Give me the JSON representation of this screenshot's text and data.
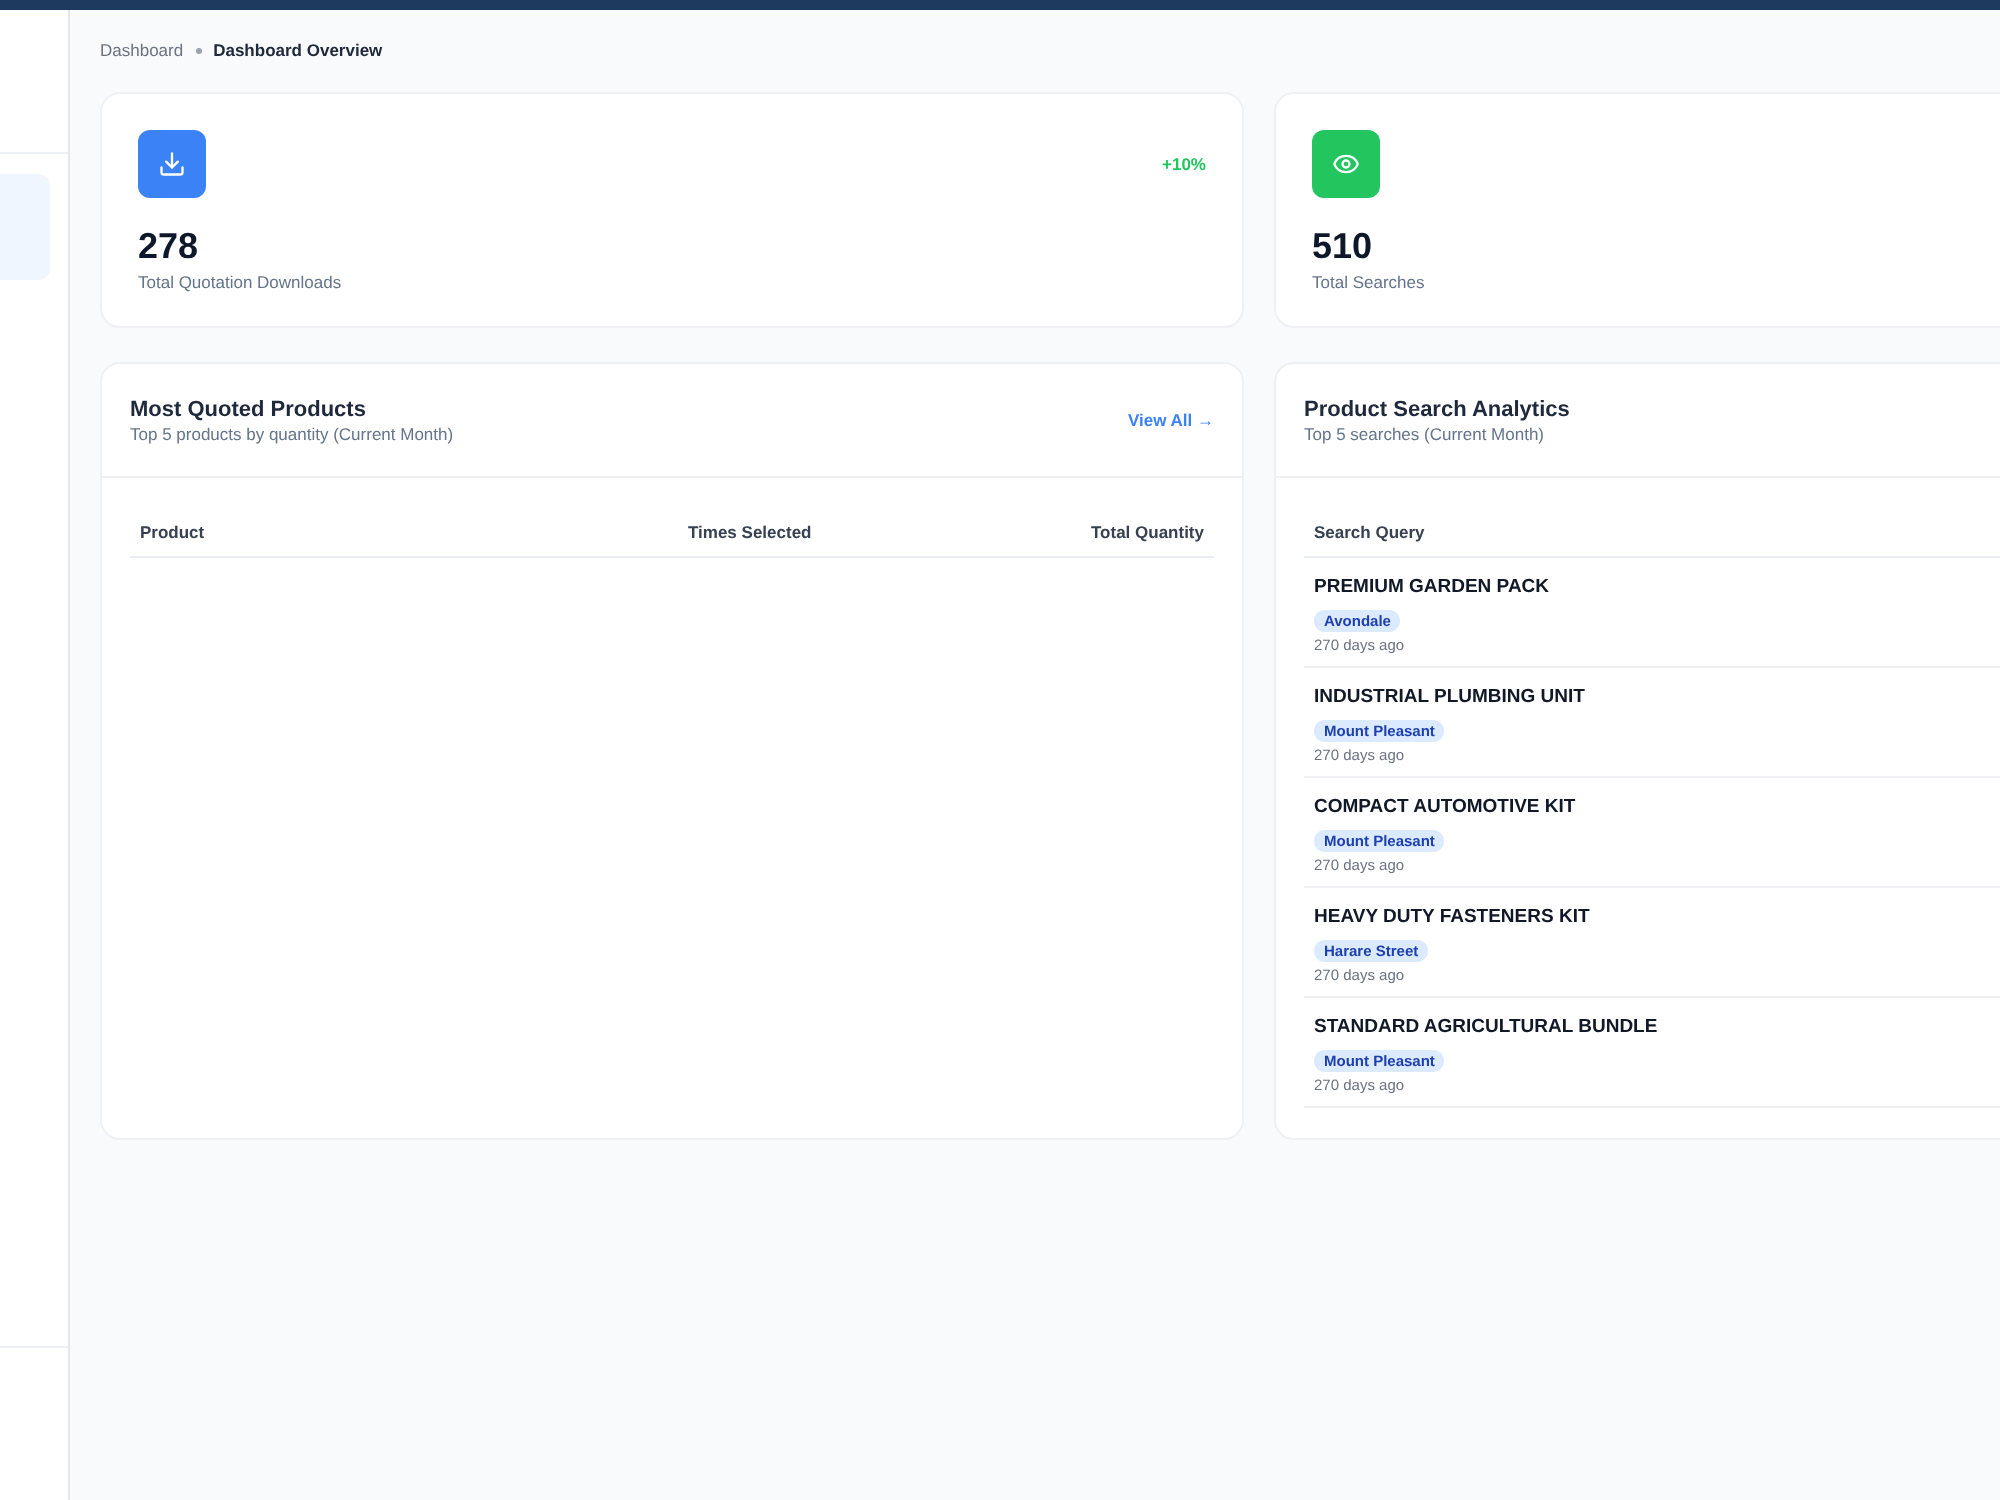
{
  "sidebar": {
    "items": [
      {
        "selected": true
      }
    ]
  },
  "breadcrumb": [
    {
      "label": "Dashboard",
      "current": false
    },
    {
      "label": "Dashboard Overview",
      "current": true
    }
  ],
  "stats": [
    {
      "value": "278",
      "label": "Total Quotation Downloads",
      "trend": "+10%",
      "color": "#3b82f6"
    },
    {
      "value": "510",
      "label": "Total Searches",
      "color": "#22c55e"
    }
  ],
  "most_quoted_products": {
    "title": "Most Quoted Products",
    "subtitle": "Top 5 products by quantity (Current Month)",
    "link": "View All →",
    "columns": [
      "Product",
      "Times Selected",
      "Total Quantity"
    ]
  },
  "product_search_analytics": {
    "title": "Product Search Analytics",
    "subtitle": "Top 5 searches (Current Month)",
    "columns": [
      "Search Query"
    ],
    "rows": [
      {
        "query": "PREMIUM GARDEN PACK",
        "location": "Avondale",
        "time": "270 days ago"
      },
      {
        "query": "INDUSTRIAL PLUMBING UNIT",
        "location": "Mount Pleasant",
        "time": "270 days ago"
      },
      {
        "query": "COMPACT AUTOMOTIVE KIT",
        "location": "Mount Pleasant",
        "time": "270 days ago"
      },
      {
        "query": "HEAVY DUTY FASTENERS KIT",
        "location": "Harare Street",
        "time": "270 days ago"
      },
      {
        "query": "STANDARD AGRICULTURAL BUNDLE",
        "location": "Mount Pleasant",
        "time": "270 days ago"
      }
    ]
  }
}
